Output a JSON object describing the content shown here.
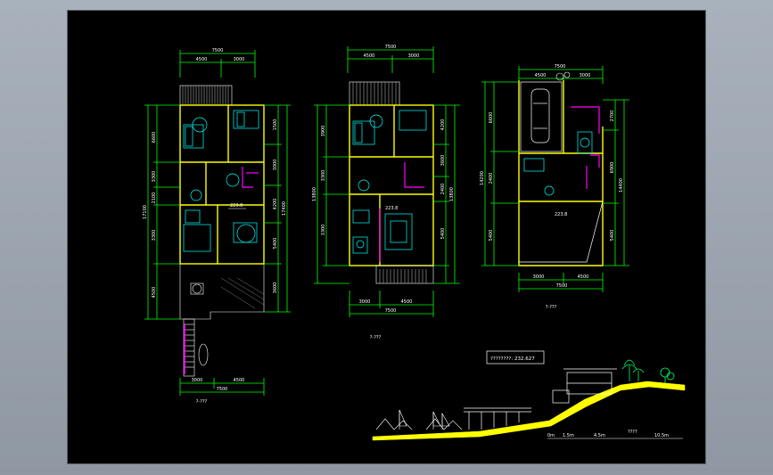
{
  "colors": {
    "background": "#000000",
    "border": "#ffffff",
    "dimension": "#00ff00",
    "wall": "#ffff00",
    "furniture": "#00ffff",
    "accent": "#ff00ff",
    "text": "#ffffff",
    "ground": "#ffff00",
    "vegetation": "#00ff66"
  },
  "plan1": {
    "dim_top_total": "7500",
    "dim_top_a": "4500",
    "dim_top_b": "3000",
    "dim_left_1": "6600",
    "dim_left_2": "3300",
    "dim_left_3": "2100",
    "dim_left_4": "3300",
    "dim_left_5": "4500",
    "dim_left_total": "17100",
    "dim_right_1": "1500",
    "dim_right_2": "3000",
    "dim_right_3": "17400",
    "dim_right_4": "4200",
    "dim_right_5": "5400",
    "dim_right_6": "3600",
    "dim_bottom_total": "7500",
    "dim_bottom_a": "3000",
    "dim_bottom_b": "4500",
    "elev_mark": "223.8",
    "caption": "?-???"
  },
  "plan2": {
    "dim_top_total": "7500",
    "dim_top_a": "4500",
    "dim_top_b": "3000",
    "dim_left_1": "3900",
    "dim_left_2": "3300",
    "dim_left_3": "3300",
    "dim_left_total": "13800",
    "dim_right_1": "4200",
    "dim_right_2": "3600",
    "dim_right_3": "2400",
    "dim_right_4": "5400",
    "dim_right_total": "13800",
    "dim_bottom_total": "7500",
    "dim_bottom_a": "3000",
    "dim_bottom_b": "4500",
    "elev_mark": "223.8",
    "caption": "?-???"
  },
  "plan3": {
    "dim_top_total": "7500",
    "dim_top_a": "4500",
    "dim_top_b": "3000",
    "dim_left_1": "6600",
    "dim_left_2": "2400",
    "dim_left_3": "5400",
    "dim_left_total": "14200",
    "dim_right_1": "2700",
    "dim_right_2": "6900",
    "dim_right_3": "5400",
    "dim_right_total": "14400",
    "dim_bottom_total": "7500",
    "dim_bottom_a": "3000",
    "dim_bottom_b": "4500",
    "elev_mark": "223.8",
    "caption": "?-???"
  },
  "section": {
    "title_box": "????????: 232.627",
    "scale_0": "0m",
    "scale_1": "1.5m",
    "scale_2": "4.5m",
    "scale_3": "10.5m",
    "scale_caption": "????"
  }
}
